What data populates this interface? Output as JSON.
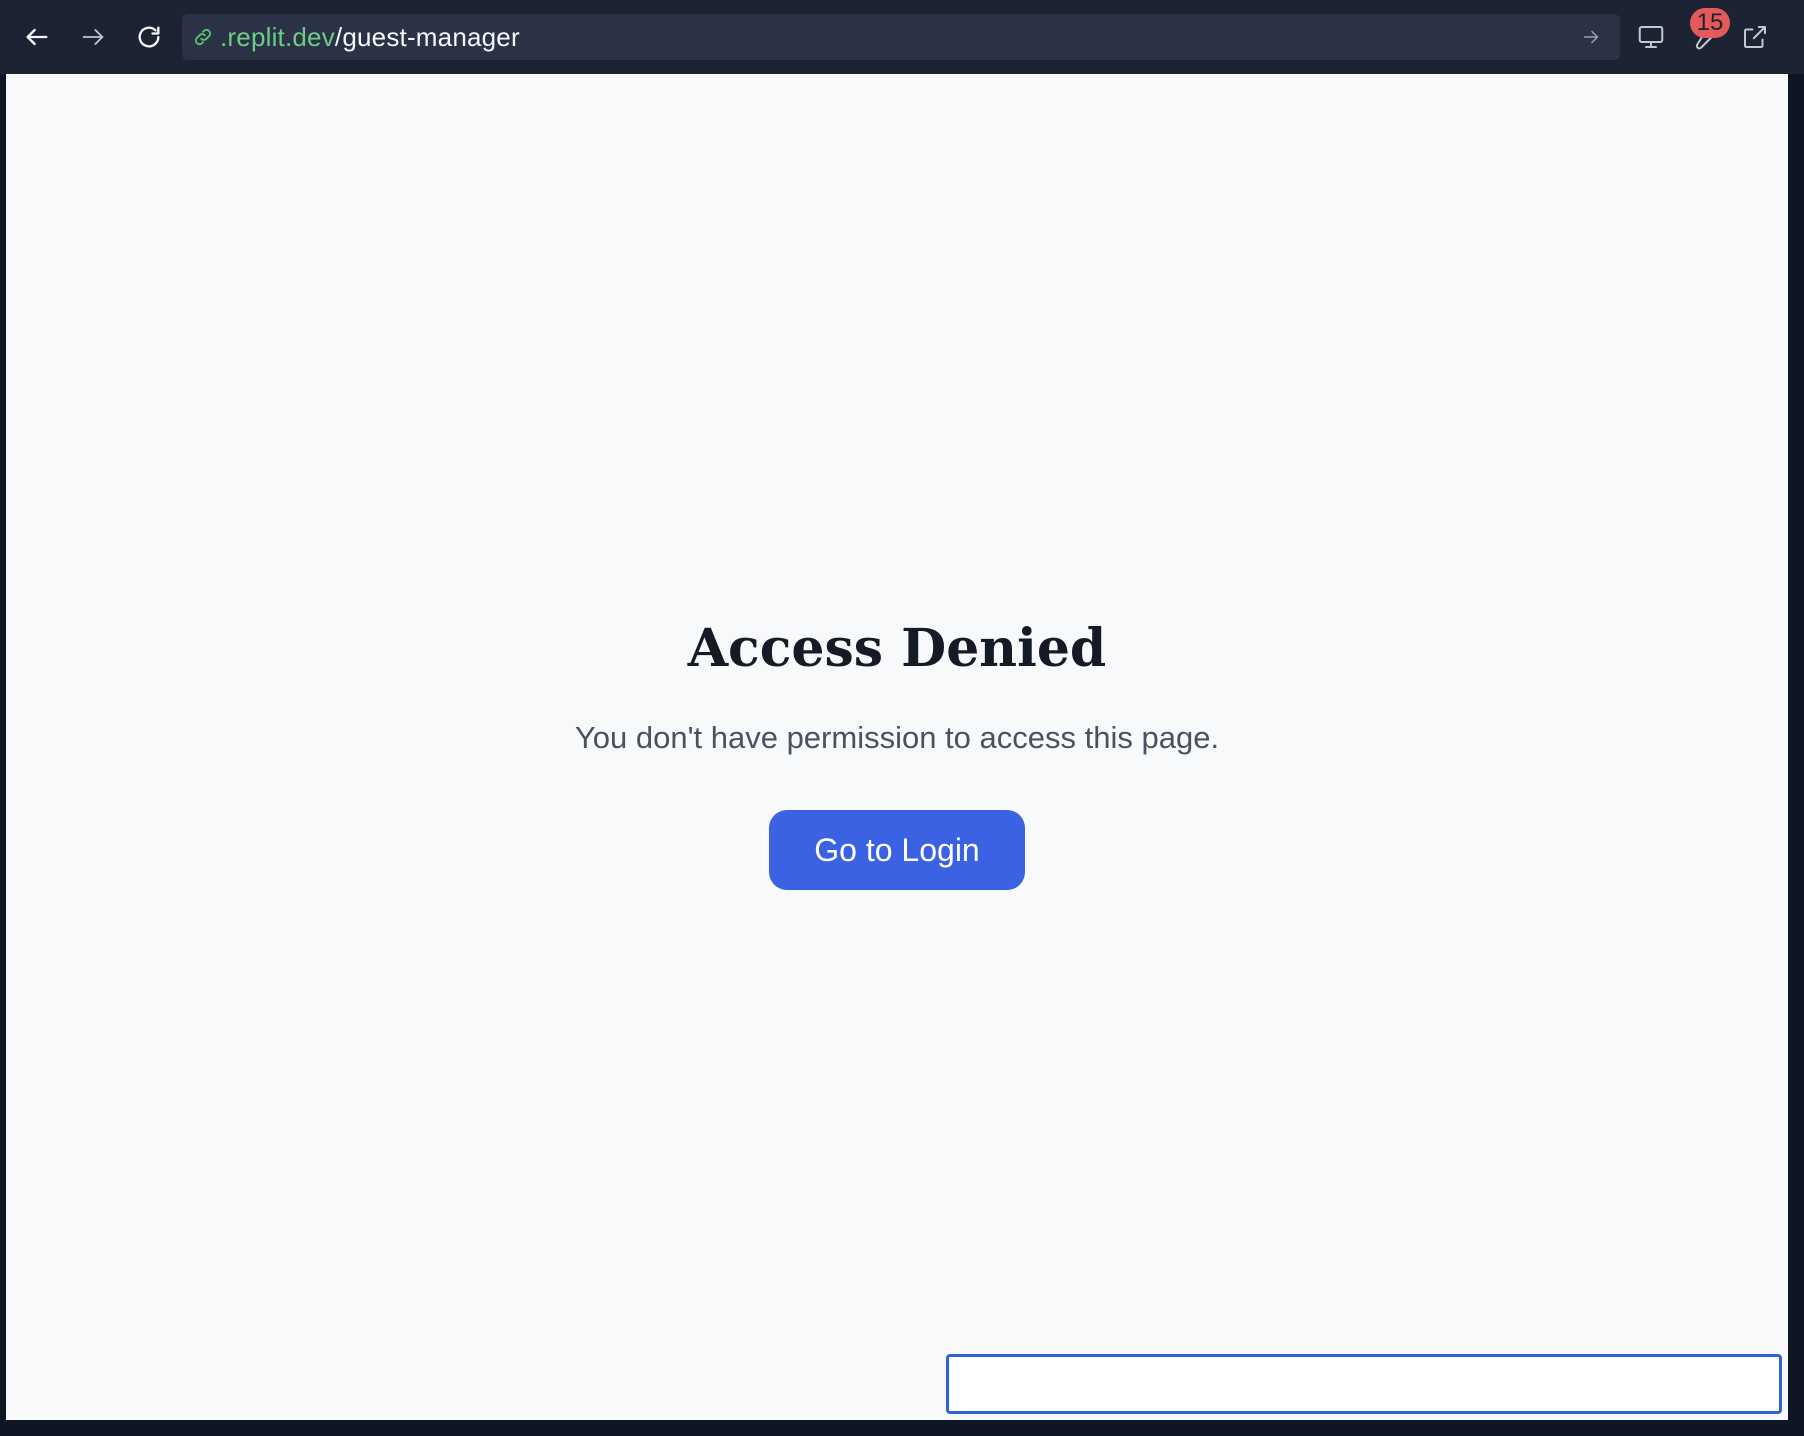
{
  "browser": {
    "url_domain": ".replit.dev",
    "url_path": "/guest-manager",
    "notification_count": "15",
    "icons": {
      "back": "arrow-left-icon",
      "forward": "arrow-right-icon",
      "reload": "reload-icon",
      "secure": "link-icon",
      "go": "arrow-right-icon",
      "devices": "monitor-icon",
      "devtools": "wrench-icon",
      "open_external": "external-link-icon"
    }
  },
  "page": {
    "title": "Access Denied",
    "message": "You don't have permission to access this page.",
    "login_button_label": "Go to Login"
  },
  "colors": {
    "accent": "#3a62e2",
    "toolbar": "#1c2333",
    "badge": "#e45a5a",
    "page_bg": "#f7f9fb"
  }
}
